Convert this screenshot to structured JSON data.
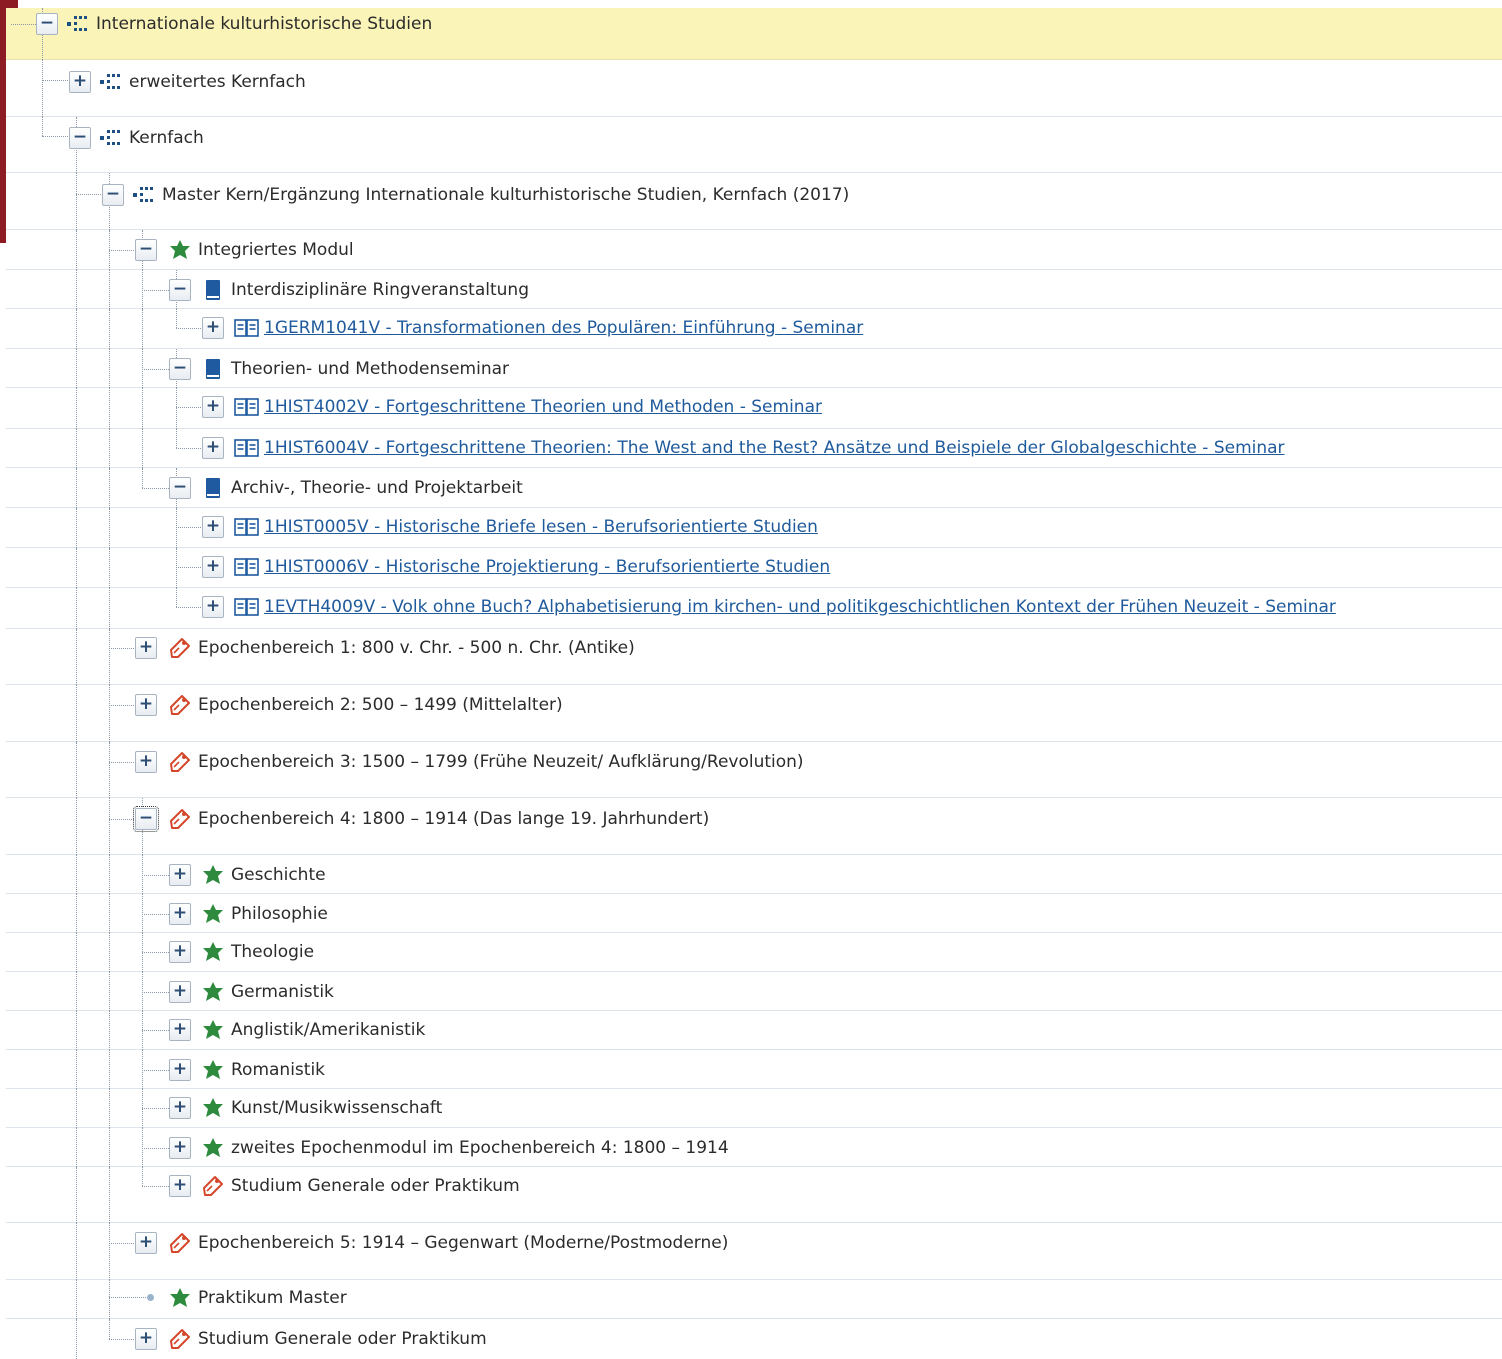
{
  "tree": [
    {
      "label": "Internationale kulturhistorische Studien",
      "toggle": "−",
      "icon": "structure-icon",
      "link": false
    },
    {
      "label": "erweitertes Kernfach",
      "toggle": "+",
      "icon": "structure-icon",
      "link": false
    },
    {
      "label": "Kernfach",
      "toggle": "−",
      "icon": "structure-icon",
      "link": false
    },
    {
      "label": "Master Kern/Ergänzung Internationale kulturhistorische Studien, Kernfach (2017)",
      "toggle": "−",
      "icon": "structure-icon",
      "link": false
    },
    {
      "label": "Integriertes Modul",
      "toggle": "−",
      "icon": "module-icon",
      "link": false
    },
    {
      "label": "Interdisziplinäre Ringveranstaltung",
      "toggle": "−",
      "icon": "book-icon",
      "link": false
    },
    {
      "label": "1GERM1041V - Transformationen des Populären: Einführung - Seminar",
      "toggle": "+",
      "icon": "course-icon",
      "link": true
    },
    {
      "label": "Theorien- und Methodenseminar",
      "toggle": "−",
      "icon": "book-icon",
      "link": false
    },
    {
      "label": "1HIST4002V - Fortgeschrittene Theorien und Methoden - Seminar",
      "toggle": "+",
      "icon": "course-icon",
      "link": true
    },
    {
      "label": "1HIST6004V - Fortgeschrittene Theorien: The West and the Rest? Ansätze und Beispiele der Globalgeschichte - Seminar",
      "toggle": "+",
      "icon": "course-icon",
      "link": true
    },
    {
      "label": "Archiv-, Theorie- und Projektarbeit",
      "toggle": "−",
      "icon": "book-icon",
      "link": false
    },
    {
      "label": "1HIST0005V - Historische Briefe lesen - Berufsorientierte Studien",
      "toggle": "+",
      "icon": "course-icon",
      "link": true
    },
    {
      "label": "1HIST0006V - Historische Projektierung - Berufsorientierte Studien",
      "toggle": "+",
      "icon": "course-icon",
      "link": true
    },
    {
      "label": "1EVTH4009V - Volk ohne Buch? Alphabetisierung im kirchen- und politikgeschichtlichen Kontext der Frühen Neuzeit - Seminar",
      "toggle": "+",
      "icon": "course-icon",
      "link": true
    },
    {
      "label": "Epochenbereich 1: 800 v. Chr. - 500 n. Chr. (Antike)",
      "toggle": "+",
      "icon": "tag-icon",
      "link": false
    },
    {
      "label": "Epochenbereich 2: 500 – 1499 (Mittelalter)",
      "toggle": "+",
      "icon": "tag-icon",
      "link": false
    },
    {
      "label": "Epochenbereich 3: 1500 – 1799 (Frühe Neuzeit/ Aufklärung/Revolution)",
      "toggle": "+",
      "icon": "tag-icon",
      "link": false
    },
    {
      "label": "Epochenbereich 4: 1800 – 1914 (Das lange 19. Jahrhundert)",
      "toggle": "−",
      "icon": "tag-icon",
      "link": false
    },
    {
      "label": "Geschichte",
      "toggle": "+",
      "icon": "module-icon",
      "link": false
    },
    {
      "label": "Philosophie",
      "toggle": "+",
      "icon": "module-icon",
      "link": false
    },
    {
      "label": "Theologie",
      "toggle": "+",
      "icon": "module-icon",
      "link": false
    },
    {
      "label": "Germanistik",
      "toggle": "+",
      "icon": "module-icon",
      "link": false
    },
    {
      "label": "Anglistik/Amerikanistik",
      "toggle": "+",
      "icon": "module-icon",
      "link": false
    },
    {
      "label": "Romanistik",
      "toggle": "+",
      "icon": "module-icon",
      "link": false
    },
    {
      "label": "Kunst/Musikwissenschaft",
      "toggle": "+",
      "icon": "module-icon",
      "link": false
    },
    {
      "label": "zweites Epochenmodul im Epochenbereich 4: 1800 – 1914",
      "toggle": "+",
      "icon": "module-icon",
      "link": false
    },
    {
      "label": "Studium Generale oder Praktikum",
      "toggle": "+",
      "icon": "tag-icon",
      "link": false
    },
    {
      "label": "Epochenbereich 5: 1914 – Gegenwart (Moderne/Postmoderne)",
      "toggle": "+",
      "icon": "tag-icon",
      "link": false
    },
    {
      "label": "Praktikum Master",
      "toggle": "",
      "icon": "module-icon",
      "link": false
    },
    {
      "label": "Studium Generale oder Praktikum",
      "toggle": "+",
      "icon": "tag-icon",
      "link": false
    }
  ]
}
